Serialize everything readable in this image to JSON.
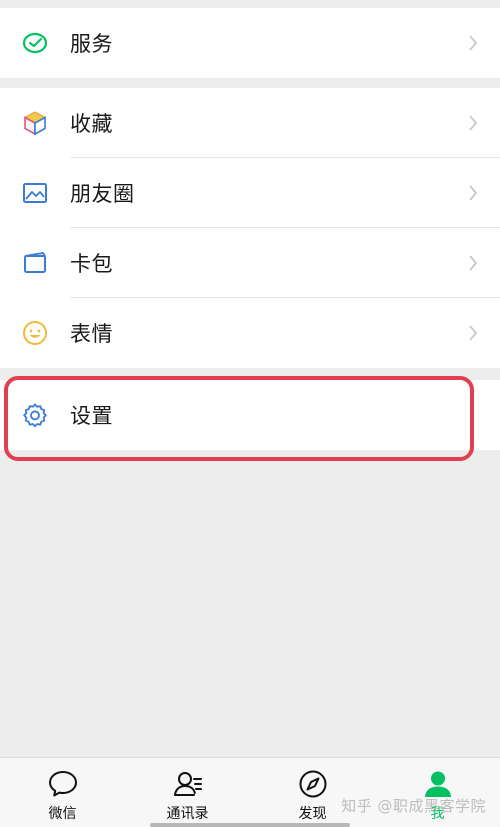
{
  "menu": {
    "services_label": "服务",
    "favorites_label": "收藏",
    "moments_label": "朋友圈",
    "cards_label": "卡包",
    "stickers_label": "表情",
    "settings_label": "设置"
  },
  "tabbar": {
    "tabs": [
      {
        "label": "微信",
        "icon": "chat-bubble-icon"
      },
      {
        "label": "通讯录",
        "icon": "contacts-icon"
      },
      {
        "label": "发现",
        "icon": "compass-icon"
      },
      {
        "label": "我",
        "icon": "me-person-icon"
      }
    ],
    "active_index": 3
  },
  "watermark": "知乎 @职成黑客学院",
  "colors": {
    "accent_green": "#07c160",
    "highlight_red": "#e0404f",
    "background": "#ededed",
    "icon_blue": "#3a7bd5"
  }
}
